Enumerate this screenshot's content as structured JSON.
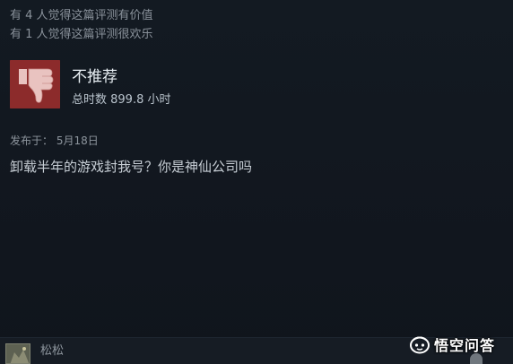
{
  "review": {
    "helpful_line": "有 4 人觉得这篇评测有价值",
    "funny_line": "有 1 人觉得这篇评测很欢乐",
    "verdict": "不推荐",
    "playtime": "总时数 899.8 小时",
    "posted": "发布于：  5月18日",
    "body": "卸载半年的游戏封我号？你是神仙公司吗",
    "thumb_icon": "thumbs-down-icon",
    "thumb_bg_color": "#8c2b2b"
  },
  "footer": {
    "username": "松松",
    "watermark": "悟空问答",
    "watermark_icon": "wukong-logo-icon"
  }
}
